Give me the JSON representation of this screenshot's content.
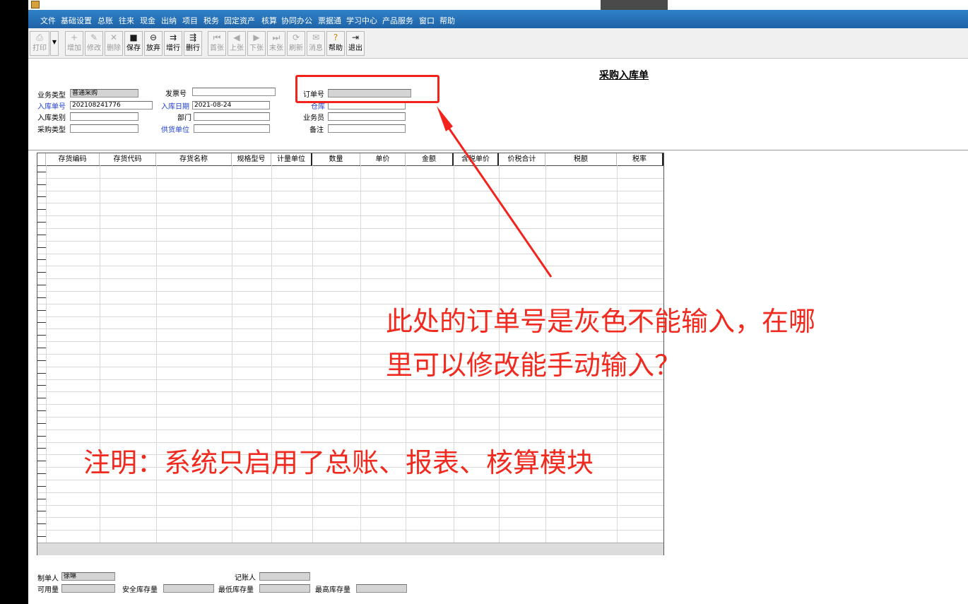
{
  "menu": [
    "文件",
    "基础设置",
    "总账",
    "往来",
    "现金",
    "出纳",
    "项目",
    "税务",
    "固定资产",
    "核算",
    "协同办公",
    "票据通",
    "学习中心",
    "产品服务",
    "窗口",
    "帮助"
  ],
  "toolbar": [
    {
      "label": "打印",
      "icon": "printer-icon",
      "glyph": "⎙",
      "state": "dis"
    },
    {
      "label": "增加",
      "icon": "add-icon",
      "glyph": "+",
      "state": "dis"
    },
    {
      "label": "修改",
      "icon": "edit-icon",
      "glyph": "✎",
      "state": "dis"
    },
    {
      "label": "删除",
      "icon": "delete-icon",
      "glyph": "✕",
      "state": "dis"
    },
    {
      "label": "保存",
      "icon": "save-icon",
      "glyph": "■",
      "state": "en"
    },
    {
      "label": "放弃",
      "icon": "discard-icon",
      "glyph": "⊖",
      "state": "en"
    },
    {
      "label": "增行",
      "icon": "add-row-icon",
      "glyph": "⇉",
      "state": "en"
    },
    {
      "label": "删行",
      "icon": "delete-row-icon",
      "glyph": "⇶",
      "state": "en"
    },
    {
      "label": "首张",
      "icon": "first-icon",
      "glyph": "⏮",
      "state": "dis"
    },
    {
      "label": "上张",
      "icon": "prev-icon",
      "glyph": "◀",
      "state": "dis"
    },
    {
      "label": "下张",
      "icon": "next-icon",
      "glyph": "▶",
      "state": "dis"
    },
    {
      "label": "末张",
      "icon": "last-icon",
      "glyph": "⏭",
      "state": "dis"
    },
    {
      "label": "刷新",
      "icon": "refresh-icon",
      "glyph": "⟳",
      "state": "dis"
    },
    {
      "label": "消息",
      "icon": "message-icon",
      "glyph": "✉",
      "state": "dis"
    },
    {
      "label": "帮助",
      "icon": "help-icon",
      "glyph": "?",
      "state": "en"
    },
    {
      "label": "退出",
      "icon": "exit-icon",
      "glyph": "⇥",
      "state": "en"
    }
  ],
  "doc_title": "采购入库单",
  "form": {
    "biz_type_label": "业务类型",
    "biz_type_value": "普通采购",
    "invoice_no_label": "发票号",
    "invoice_no_value": "",
    "order_no_label": "订单号",
    "order_no_value": "",
    "receipt_no_label": "入库单号",
    "receipt_no_value": "202108241776",
    "receipt_date_label": "入库日期",
    "receipt_date_value": "2021-08-24",
    "warehouse_label": "仓库",
    "warehouse_value": "",
    "receipt_cat_label": "入库类别",
    "receipt_cat_value": "",
    "dept_label": "部门",
    "dept_value": "",
    "clerk_label": "业务员",
    "clerk_value": "",
    "purchase_type_label": "采购类型",
    "purchase_type_value": "",
    "supplier_label": "供货单位",
    "supplier_value": "",
    "remark_label": "备注",
    "remark_value": ""
  },
  "columns": [
    "存货编码",
    "存货代码",
    "存货名称",
    "规格型号",
    "计量单位",
    "数量",
    "单价",
    "金额",
    "含税单价",
    "价税合计",
    "税额",
    "税率"
  ],
  "footer": {
    "maker_label": "制单人",
    "maker_value": "徐琳",
    "bookkeeper_label": "记账人",
    "bookkeeper_value": "",
    "available_label": "可用量",
    "available_value": "",
    "safety_label": "安全库存量",
    "safety_value": "",
    "min_label": "最低库存量",
    "min_value": "",
    "max_label": "最高库存量",
    "max_value": ""
  },
  "annotations": {
    "question_line1": "此处的订单号是灰色不能输入，在哪",
    "question_line2": "里可以修改能手动输入？",
    "note": "注明：系统只启用了总账、报表、核算模块",
    "color": "#f02a1f"
  }
}
